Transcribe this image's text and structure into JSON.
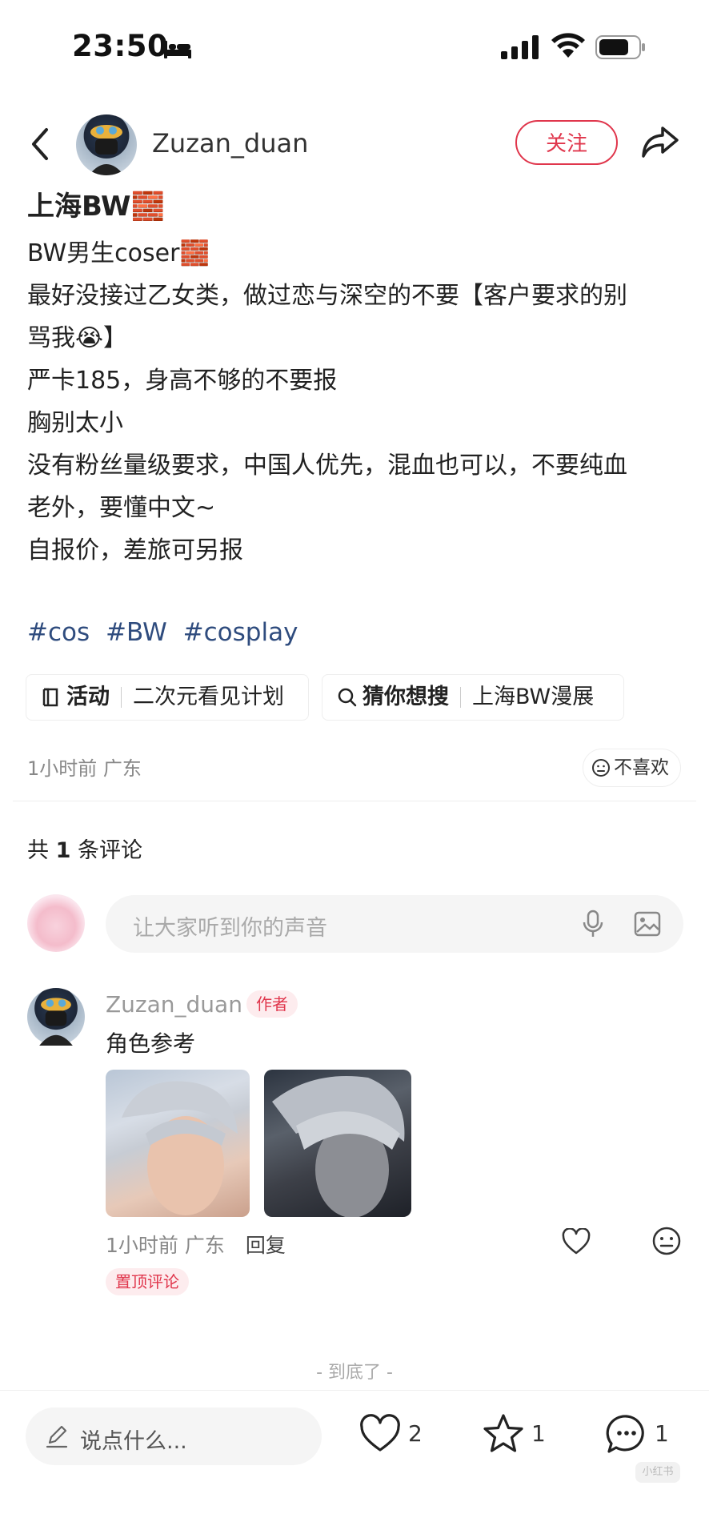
{
  "status_bar": {
    "time": "23:50"
  },
  "header": {
    "author_name": "Zuzan_duan",
    "follow_label": "关注"
  },
  "post": {
    "title": "上海BW🧱",
    "lines": [
      "BW男生coser🧱",
      "最好没接过乙女类，做过恋与深空的不要【客户要求的别",
      "骂我😭】",
      "严卡185，身高不够的不要报",
      "胸别太小",
      "没有粉丝量级要求，中国人优先，混血也可以，不要纯血",
      "老外，要懂中文~",
      "自报价，差旅可另报"
    ],
    "tags": [
      "#cos",
      "#BW",
      "#cosplay"
    ],
    "chips": [
      {
        "key": "活动",
        "value": "二次元看见计划",
        "icon": "activity-icon"
      },
      {
        "key": "猜你想搜",
        "value": "上海BW漫展",
        "icon": "search-icon"
      }
    ],
    "meta": "1小时前 广东",
    "dislike_label": "不喜欢"
  },
  "comments_header": {
    "prefix": "共 ",
    "count": "1",
    "suffix": " 条评论"
  },
  "comment_input": {
    "placeholder": "让大家听到你的声音"
  },
  "comment": {
    "name": "Zuzan_duan",
    "badge": "作者",
    "text": "角色参考",
    "meta": "1小时前 广东",
    "reply_label": "回复",
    "pinned_label": "置顶评论"
  },
  "end_text": "- 到底了 -",
  "bottom_bar": {
    "input_placeholder": "说点什么...",
    "likes": "2",
    "stars": "1",
    "comments": "1"
  },
  "watermark": "小红书",
  "colors": {
    "accent": "#e0364c",
    "tag": "#2f4c7e"
  }
}
